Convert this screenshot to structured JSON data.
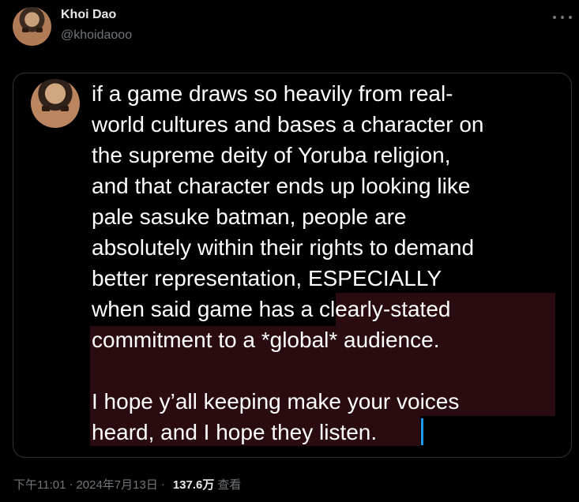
{
  "author": {
    "display_name": "Khoi Dao",
    "handle": "@khoidaooo"
  },
  "note": {
    "text": "if a game draws so heavily from real-\nworld cultures and bases a character on\nthe supreme deity of Yoruba religion,\nand that character ends up looking like\npale sasuke batman, people are\nabsolutely within their rights to demand\nbetter representation, ESPECIALLY\nwhen said game  has a clearly-stated\ncommitment to a *global* audience.\n\nI hope y’all keeping make your voices\nheard, and I hope they listen."
  },
  "meta": {
    "time": "下午11:01",
    "separator": "·",
    "date": "2024年7月13日",
    "views_count": "137.6万",
    "views_label": "查看"
  },
  "colors": {
    "background": "#000000",
    "text_primary": "#e7e9ea",
    "text_secondary": "#71767b",
    "highlight": "#2a0c10",
    "cursor": "#1d9bf0"
  },
  "icons": {
    "more": "more-horizontal-icon"
  }
}
